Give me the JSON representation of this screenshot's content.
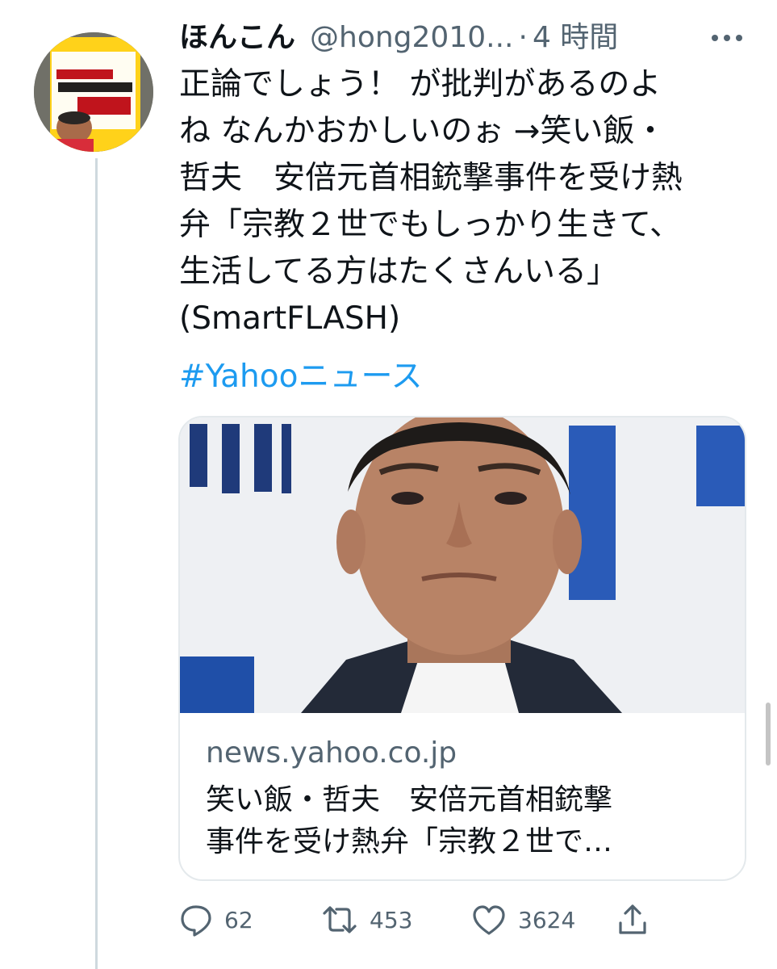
{
  "tweet": {
    "display_name": "ほんこん",
    "handle": "@hong2010...",
    "separator": "·",
    "time": "4 時間",
    "text": "正論でしょう！ が批判があるのよ\nね なんかおかしいのぉ →笑い飯・\n哲夫　安倍元首相銃撃事件を受け熱\n弁「宗教２世でもしっかり生きて、\n生活してる方はたくさんいる」\n(SmartFLASH)",
    "hashtag": "#Yahooニュース"
  },
  "avatar": {
    "book_title": "ウイルスから国民を守るのも国防や！",
    "book_brand": "ほんこん"
  },
  "link_card": {
    "domain": "news.yahoo.co.jp",
    "title": "笑い飯・哲夫　安倍元首相銃撃\n事件を受け熱弁「宗教２世で…"
  },
  "actions": {
    "reply_count": "62",
    "retweet_count": "453",
    "like_count": "3624"
  },
  "icons": {
    "more": "more-icon",
    "reply": "reply-icon",
    "retweet": "retweet-icon",
    "like": "like-icon",
    "share": "share-icon"
  },
  "colors": {
    "accent": "#1d9bf0",
    "text": "#0f1419",
    "secondary": "#536471",
    "border": "#e4e9ec"
  }
}
